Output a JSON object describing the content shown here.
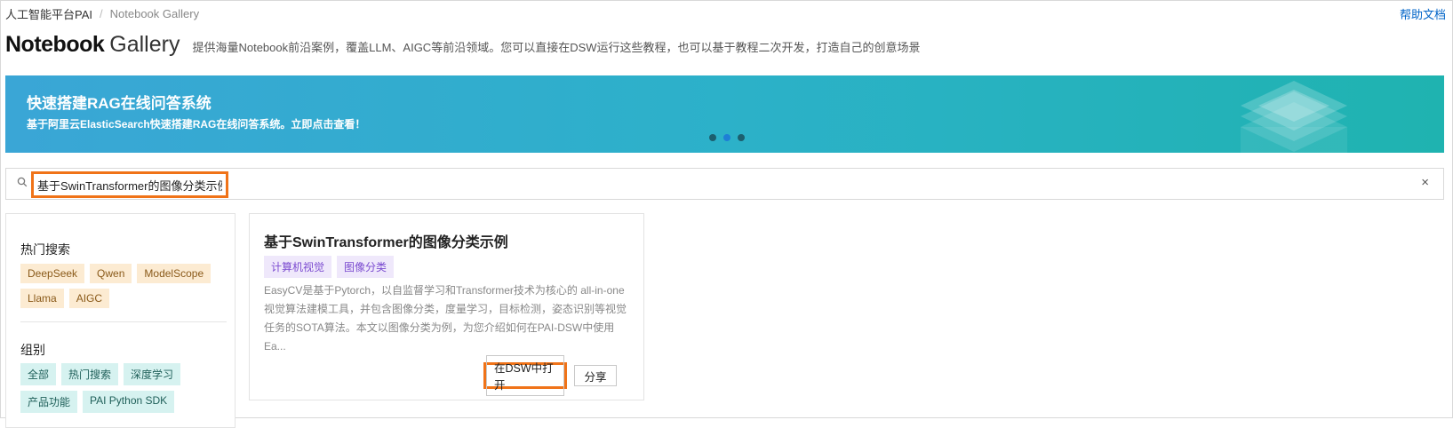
{
  "breadcrumb": {
    "root": "人工智能平台PAI",
    "separator": "/",
    "current": "Notebook Gallery"
  },
  "header": {
    "help_link": "帮助文档",
    "title_bold": "Notebook",
    "title_light": "Gallery",
    "subtitle": "提供海量Notebook前沿案例，覆盖LLM、AIGC等前沿领域。您可以直接在DSW运行这些教程，也可以基于教程二次开发，打造自己的创意场景"
  },
  "banner": {
    "title": "快速搭建RAG在线问答系统",
    "description": "基于阿里云ElasticSearch快速搭建RAG在线问答系统。立即点击查看！",
    "slide_count": 3,
    "active_slide": 2
  },
  "search": {
    "value": "基于SwinTransformer的图像分类示例",
    "clear": "×"
  },
  "sidebar": {
    "hot_title": "热门搜索",
    "hot_tags": [
      "DeepSeek",
      "Qwen",
      "ModelScope",
      "Llama",
      "AIGC"
    ],
    "group_title": "组别",
    "group_tags": [
      "全部",
      "热门搜索",
      "深度学习",
      "产品功能",
      "PAI Python SDK"
    ]
  },
  "card": {
    "title": "基于SwinTransformer的图像分类示例",
    "tags": [
      "计算机视觉",
      "图像分类"
    ],
    "description": "EasyCV是基于Pytorch，以自监督学习和Transformer技术为核心的 all-in-one 视觉算法建模工具，并包含图像分类，度量学习，目标检测，姿态识别等视觉任务的SOTA算法。本文以图像分类为例，为您介绍如何在PAI-DSW中使用Ea...",
    "open_button": "在DSW中打开",
    "share_button": "分享"
  },
  "colors": {
    "accent": "#f07318",
    "link": "#0064c8",
    "banner_start": "#3aa6d6",
    "banner_end": "#1fb3b0"
  }
}
